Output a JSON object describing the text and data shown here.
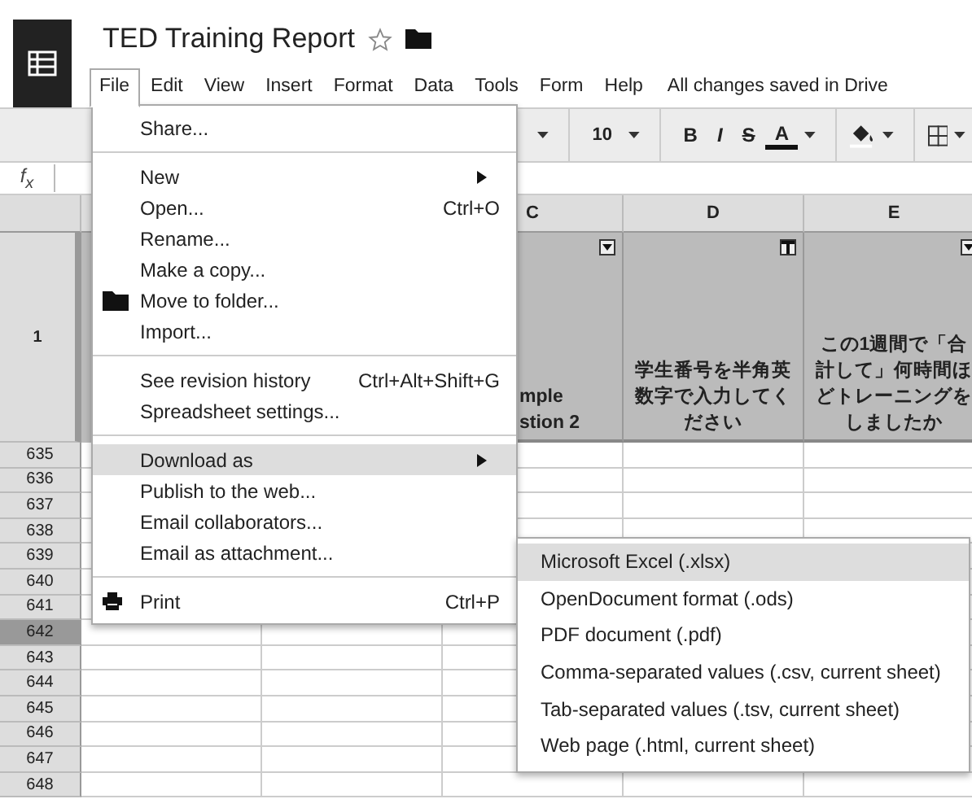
{
  "app": {
    "title": "TED Training Report",
    "starred": false
  },
  "menubar": [
    {
      "label": "File",
      "selected": true
    },
    {
      "label": "Edit",
      "selected": false
    },
    {
      "label": "View",
      "selected": false
    },
    {
      "label": "Insert",
      "selected": false
    },
    {
      "label": "Format",
      "selected": false
    },
    {
      "label": "Data",
      "selected": false
    },
    {
      "label": "Tools",
      "selected": false
    },
    {
      "label": "Form",
      "selected": false
    },
    {
      "label": "Help",
      "selected": false
    }
  ],
  "save_status": "All changes saved in Drive",
  "toolbar": {
    "font_size": "10",
    "format_buttons": [
      {
        "label": "B",
        "kind": "bold"
      },
      {
        "label": "I",
        "kind": "italic"
      },
      {
        "label": "S",
        "kind": "strike"
      },
      {
        "label": "A",
        "kind": "color"
      }
    ]
  },
  "formula_bar": {
    "label": "f$_{x}$"
  },
  "sheet": {
    "columns": [
      {
        "label": "C"
      },
      {
        "label": "D"
      },
      {
        "label": "E"
      }
    ],
    "header_row": {
      "number": "1",
      "cells": [
        {
          "text": "mple\nstion 2",
          "filter_active": false,
          "kind": "clipped"
        },
        {
          "text": "学生番号を半角英数字で入力してください",
          "filter_active": true,
          "kind": "full"
        },
        {
          "text": "この1週間で「合計して」何時間ほどトレーニングをしましたか",
          "filter_active": false,
          "kind": "full"
        }
      ]
    },
    "rows": [
      {
        "number": "635",
        "selected": false
      },
      {
        "number": "636",
        "selected": false
      },
      {
        "number": "637",
        "selected": false
      },
      {
        "number": "638",
        "selected": false
      },
      {
        "number": "639",
        "selected": false
      },
      {
        "number": "640",
        "selected": false
      },
      {
        "number": "641",
        "selected": false
      },
      {
        "number": "642",
        "selected": true
      },
      {
        "number": "643",
        "selected": false
      },
      {
        "number": "644",
        "selected": false
      },
      {
        "number": "645",
        "selected": false
      },
      {
        "number": "646",
        "selected": false
      },
      {
        "number": "647",
        "selected": false
      },
      {
        "number": "648",
        "selected": false
      }
    ]
  },
  "file_menu": {
    "sections": [
      [
        {
          "label": "Share...",
          "kind": "plain",
          "selected": false
        }
      ],
      [
        {
          "label": "New",
          "kind": "plain",
          "submenu": true,
          "selected": false
        },
        {
          "label": "Open...",
          "kind": "plain",
          "shortcut": "Ctrl+O",
          "selected": false
        },
        {
          "label": "Rename...",
          "kind": "plain",
          "selected": false
        },
        {
          "label": "Make a copy...",
          "kind": "plain",
          "selected": false
        },
        {
          "label": "Move to folder...",
          "kind": "folder",
          "selected": false
        },
        {
          "label": "Import...",
          "kind": "plain",
          "selected": false
        }
      ],
      [
        {
          "label": "See revision history",
          "kind": "plain",
          "shortcut": "Ctrl+Alt+Shift+G",
          "selected": false
        },
        {
          "label": "Spreadsheet settings...",
          "kind": "plain",
          "selected": false
        }
      ],
      [
        {
          "label": "Download as",
          "kind": "plain",
          "submenu": true,
          "selected": true
        },
        {
          "label": "Publish to the web...",
          "kind": "plain",
          "selected": false
        },
        {
          "label": "Email collaborators...",
          "kind": "plain",
          "selected": false
        },
        {
          "label": "Email as attachment...",
          "kind": "plain",
          "selected": false
        }
      ],
      [
        {
          "label": "Print",
          "kind": "printer",
          "shortcut": "Ctrl+P",
          "selected": false
        }
      ]
    ]
  },
  "download_menu": [
    {
      "label": "Microsoft Excel (.xlsx)",
      "selected": true
    },
    {
      "label": "OpenDocument format (.ods)",
      "selected": false
    },
    {
      "label": "PDF document (.pdf)",
      "selected": false
    },
    {
      "label": "Comma-separated values (.csv, current sheet)",
      "selected": false
    },
    {
      "label": "Tab-separated values (.tsv, current sheet)",
      "selected": false
    },
    {
      "label": "Web page (.html, current sheet)",
      "selected": false
    }
  ]
}
